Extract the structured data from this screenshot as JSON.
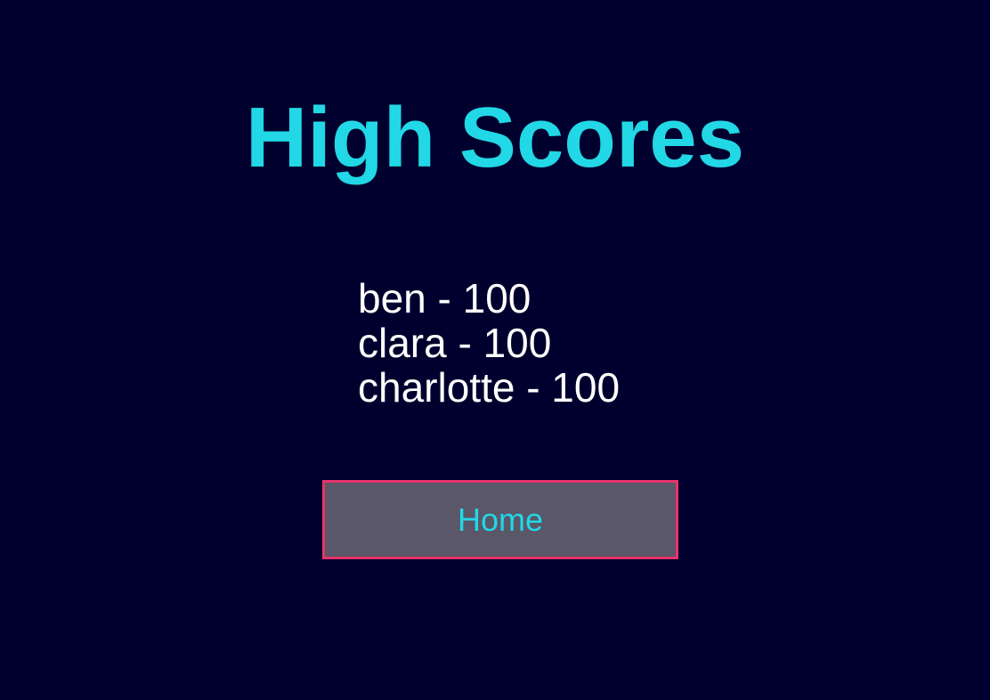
{
  "title": "High Scores",
  "scores": [
    {
      "name": "ben",
      "score": 100,
      "text": "ben - 100"
    },
    {
      "name": "clara",
      "score": 100,
      "text": "clara - 100"
    },
    {
      "name": "charlotte",
      "score": 100,
      "text": "charlotte - 100"
    }
  ],
  "home_button": {
    "label": "Home"
  },
  "colors": {
    "background": "#00002e",
    "accent": "#22d7e6",
    "button_border": "#e6336b",
    "button_fill": "#5a5768",
    "text": "#ffffff"
  }
}
